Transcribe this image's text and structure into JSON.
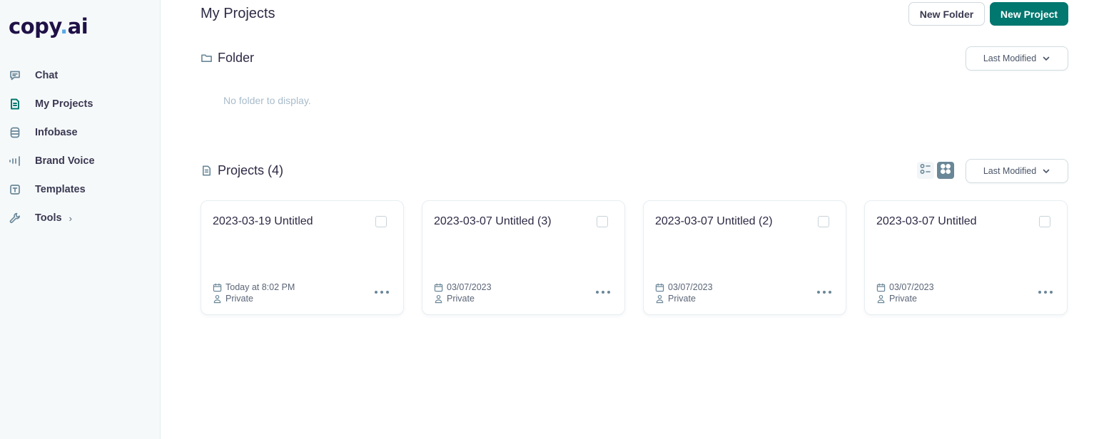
{
  "brand": {
    "name_part1": "copy",
    "dot": ".",
    "name_part2": "ai",
    "accent": "#00776f"
  },
  "sidebar": {
    "items": [
      {
        "label": "Chat",
        "icon": "chat-icon",
        "active": false
      },
      {
        "label": "My Projects",
        "icon": "document-icon",
        "active": true
      },
      {
        "label": "Infobase",
        "icon": "database-icon",
        "active": false
      },
      {
        "label": "Brand Voice",
        "icon": "sound-wave-icon",
        "active": false
      },
      {
        "label": "Templates",
        "icon": "template-icon",
        "active": false
      },
      {
        "label": "Tools",
        "icon": "wrench-icon",
        "active": false,
        "has_submenu": true
      }
    ],
    "tools_chevron": "›"
  },
  "header": {
    "title": "My Projects",
    "new_folder_label": "New Folder",
    "new_project_label": "New Project"
  },
  "folder_section": {
    "title": "Folder",
    "sort_label": "Last Modified",
    "empty_message": "No folder to display."
  },
  "projects_section": {
    "title": "Projects (4)",
    "sort_label": "Last Modified",
    "view_mode": "grid",
    "projects": [
      {
        "title": "2023-03-19 Untitled",
        "date": "Today at 8:02 PM",
        "visibility": "Private",
        "checked": false
      },
      {
        "title": "2023-03-07 Untitled (3)",
        "date": "03/07/2023",
        "visibility": "Private",
        "checked": false
      },
      {
        "title": "2023-03-07 Untitled (2)",
        "date": "03/07/2023",
        "visibility": "Private",
        "checked": false
      },
      {
        "title": "2023-03-07 Untitled",
        "date": "03/07/2023",
        "visibility": "Private",
        "checked": false
      }
    ]
  }
}
